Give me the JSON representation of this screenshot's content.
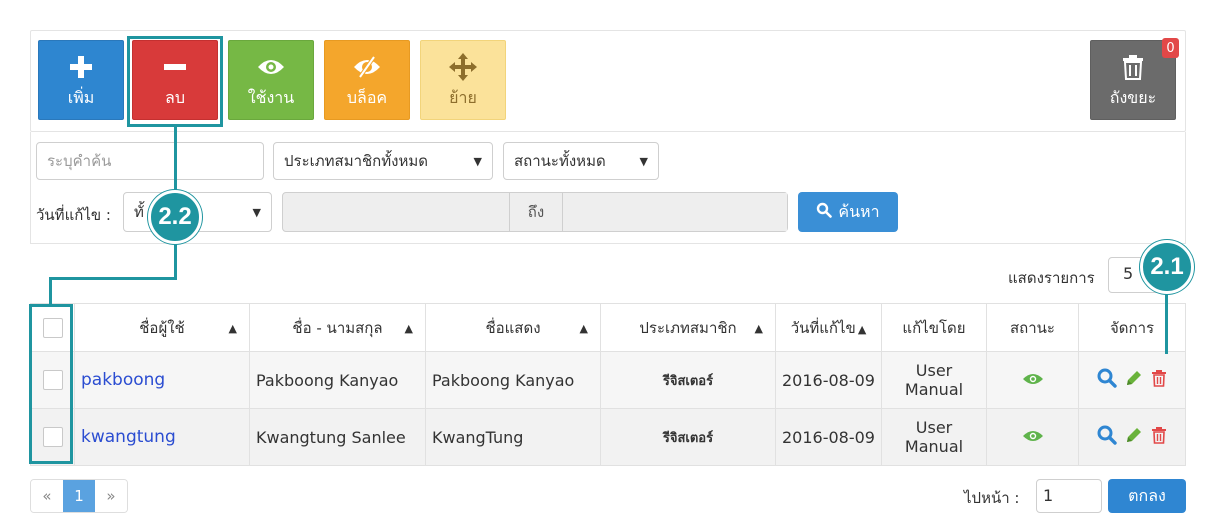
{
  "toolbar": {
    "add_label": "เพิ่ม",
    "delete_label": "ลบ",
    "enable_label": "ใช้งาน",
    "block_label": "บล็อค",
    "move_label": "ย้าย",
    "trash_label": "ถังขยะ",
    "trash_count": "0"
  },
  "filters": {
    "keyword_placeholder": "ระบุคำค้น",
    "member_type": "ประเภทสมาชิกทั้งหมด",
    "status": "สถานะทั้งหมด",
    "date_label": "วันที่แก้ไข :",
    "date_select": "ทั้",
    "date_to": "ถึง",
    "search_label": "ค้นหา"
  },
  "markers": {
    "m1": "2.2",
    "m2": "2.1"
  },
  "page_size": {
    "label": "แสดงรายการ",
    "value": "5"
  },
  "table": {
    "headers": {
      "username": "ชื่อผู้ใช้",
      "fullname": "ชื่อ - นามสกุล",
      "display": "ชื่อแสดง",
      "type": "ประเภทสมาชิก",
      "modified": "วันที่แก้ไข",
      "modified_by": "แก้ไขโดย",
      "status": "สถานะ",
      "actions": "จัดการ"
    },
    "rows": [
      {
        "username": "pakboong",
        "fullname": "Pakboong Kanyao",
        "display": "Pakboong Kanyao",
        "type": "รีจิสเตอร์",
        "modified": "2016-08-09",
        "modified_by": "User Manual"
      },
      {
        "username": "kwangtung",
        "fullname": "Kwangtung Sanlee",
        "display": "KwangTung",
        "type": "รีจิสเตอร์",
        "modified": "2016-08-09",
        "modified_by": "User Manual"
      }
    ]
  },
  "pagination": {
    "prev": "«",
    "current": "1",
    "next": "»",
    "goto_label": "ไปหน้า :",
    "goto_value": "1",
    "ok_label": "ตกลง"
  },
  "colors": {
    "accent": "#1f95a0",
    "primary": "#2e86d0",
    "danger": "#d83a3a",
    "success": "#76b845",
    "warning": "#f4a62c"
  }
}
